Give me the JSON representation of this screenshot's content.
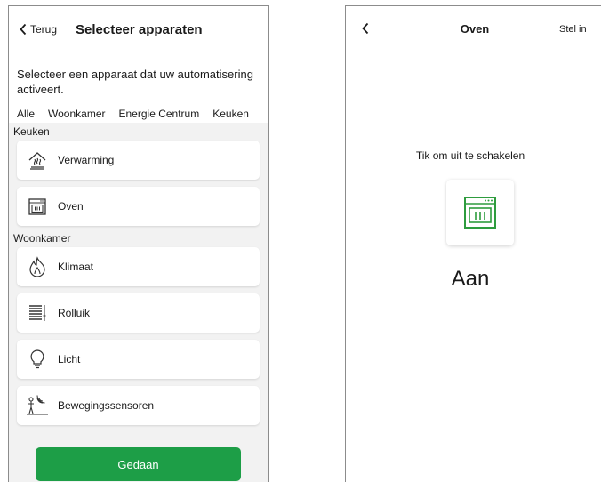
{
  "left": {
    "back_label": "Terug",
    "title": "Selecteer apparaten",
    "description": "Selecteer een apparaat dat uw automatisering activeert.",
    "tabs": [
      "Alle",
      "Woonkamer",
      "Energie Centrum",
      "Keuken"
    ],
    "active_tab": "Alle",
    "sections": [
      {
        "label": "Keuken",
        "items": [
          {
            "label": "Verwarming",
            "icon": "heater-icon"
          },
          {
            "label": "Oven",
            "icon": "oven-icon"
          }
        ]
      },
      {
        "label": "Woonkamer",
        "items": [
          {
            "label": "Klimaat",
            "icon": "flame-icon"
          },
          {
            "label": "Rolluik",
            "icon": "shutter-icon"
          },
          {
            "label": "Licht",
            "icon": "bulb-icon"
          },
          {
            "label": "Bewegingssensoren",
            "icon": "motion-sensor-icon"
          }
        ]
      }
    ],
    "done_label": "Gedaan"
  },
  "right": {
    "title": "Oven",
    "setup_label": "Stel in",
    "hint": "Tik om uit te schakelen",
    "state": "Aan",
    "accent": "#2e9c3e"
  },
  "colors": {
    "primary_button": "#1d9e47",
    "tab_indicator": "#3dcd58"
  }
}
